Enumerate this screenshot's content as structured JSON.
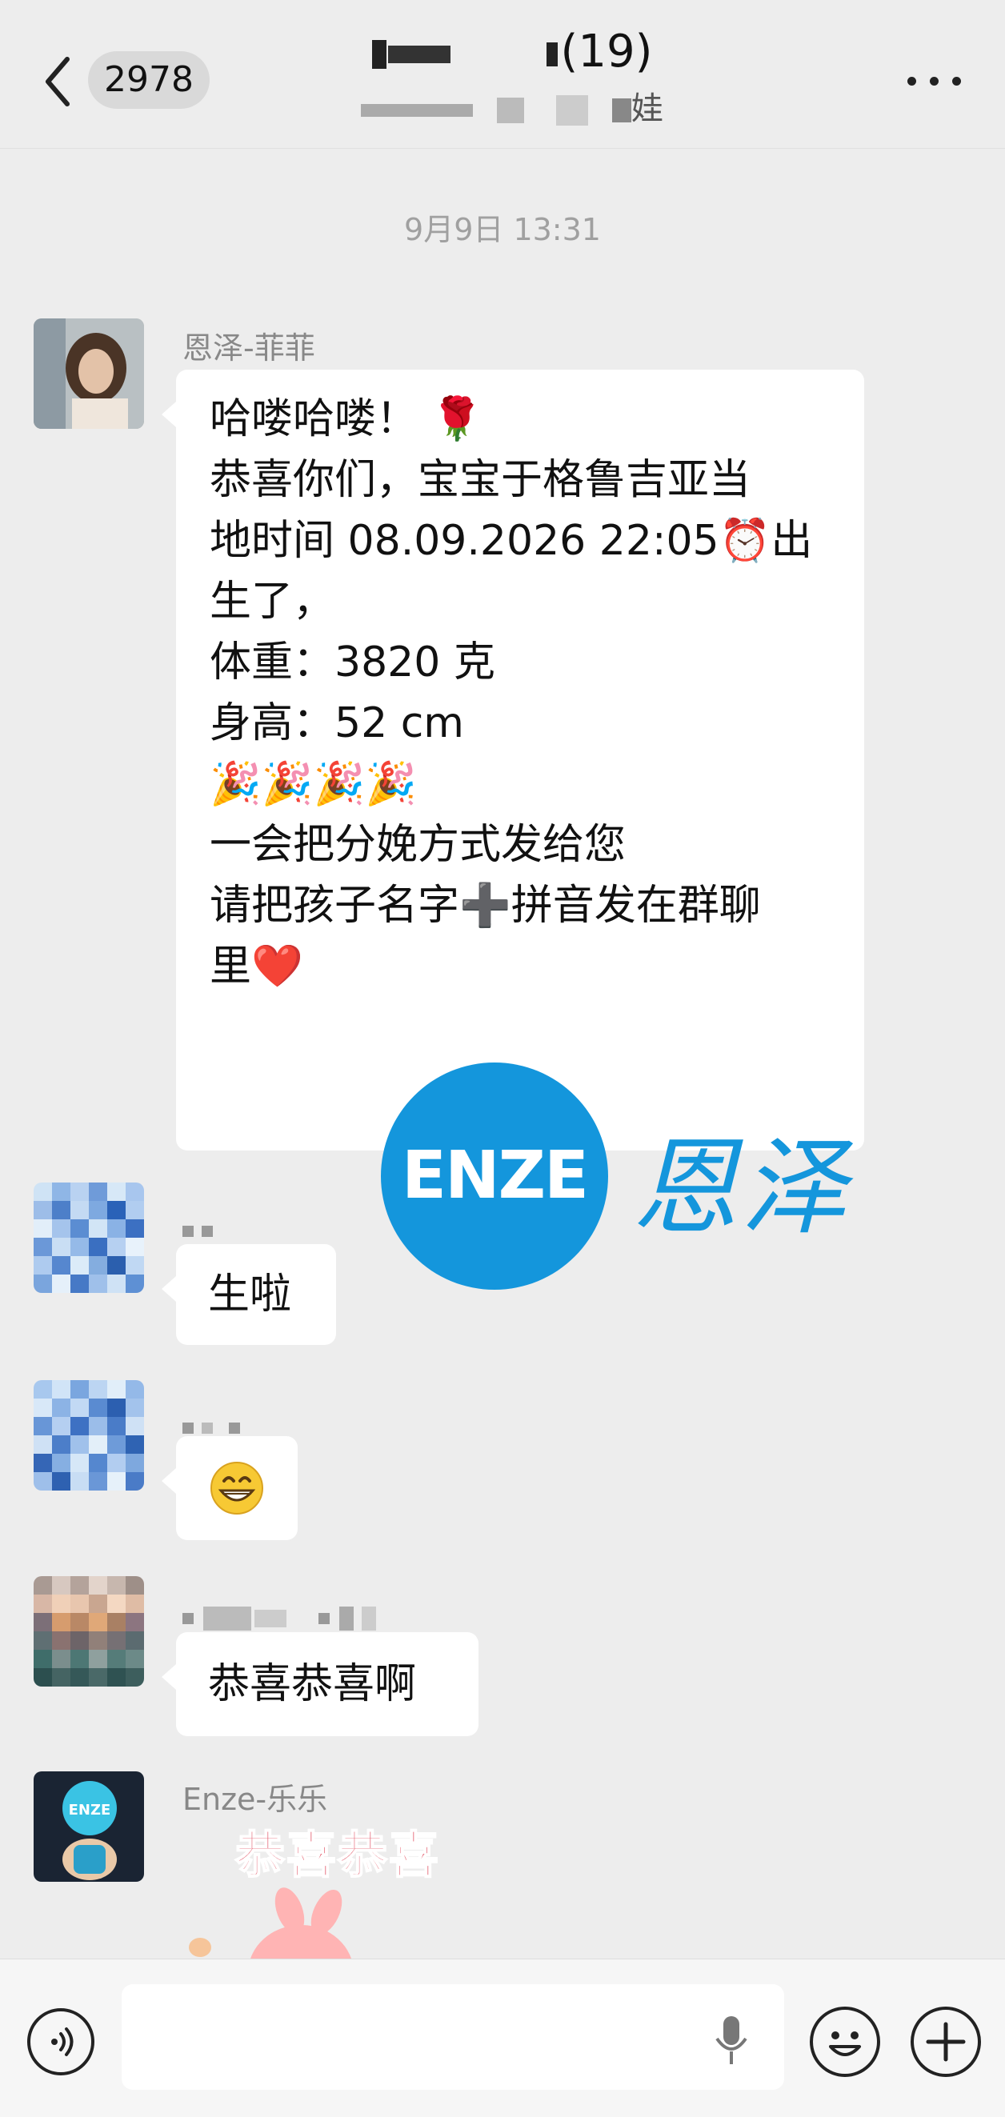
{
  "header": {
    "unread_count": "2978",
    "title_visible_suffix": "(19)",
    "subtitle_visible_suffix": "娃"
  },
  "chat": {
    "timestamp": "9月9日 13:31",
    "messages": [
      {
        "sender": "恩泽-菲菲",
        "lines": [
          "哈喽哈喽！ 🌹",
          "恭喜你们，宝宝于格鲁吉亚当",
          "地时间 08.09.2026 22:05⏰出",
          "生了，",
          "体重：3820 克",
          "身高：52 cm",
          "",
          "",
          "🎉🎉🎉🎉",
          "一会把分娩方式发给您",
          "请把孩子名字➕拼音发在群聊",
          "里❤️"
        ]
      },
      {
        "sender": "",
        "text": "生啦"
      },
      {
        "sender": "",
        "text": "😁"
      },
      {
        "sender": "",
        "text": "恭喜恭喜啊"
      },
      {
        "sender": "Enze-乐乐",
        "sticker_text": "恭喜恭喜"
      }
    ]
  },
  "watermark": {
    "logo_text": "ENZE",
    "cn_text": "恩泽",
    "brand_color": "#1496dc"
  },
  "icons": {
    "back": "chevron-left-icon",
    "more": "more-dots-icon",
    "voice": "voice-icon",
    "mic": "mic-icon",
    "emoji": "emoji-icon",
    "plus": "plus-icon"
  }
}
